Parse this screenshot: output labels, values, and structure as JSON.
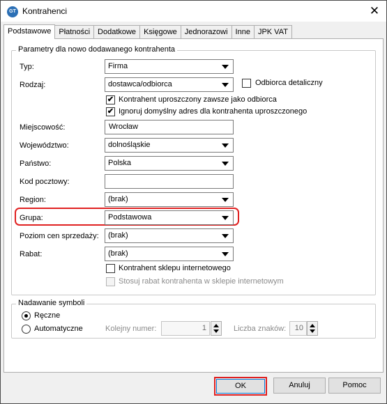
{
  "window": {
    "title": "Kontrahenci",
    "app_icon_text": "GT",
    "close_icon": "close-x-icon"
  },
  "tabs": [
    "Podstawowe",
    "Płatności",
    "Dodatkowe",
    "Księgowe",
    "Jednorazowi",
    "Inne",
    "JPK VAT"
  ],
  "params": {
    "legend": "Parametry dla nowo dodawanego kontrahenta",
    "typ": {
      "label": "Typ:",
      "value": "Firma"
    },
    "rodzaj": {
      "label": "Rodzaj:",
      "value": "dostawca/odbiorca"
    },
    "odbiorca_detaliczny": {
      "label": "Odbiorca detaliczny",
      "checked": false
    },
    "uproszczony": {
      "label": "Kontrahent uproszczony zawsze jako odbiorca",
      "checked": true
    },
    "ignoruj": {
      "label": "Ignoruj domyślny adres dla kontrahenta uproszczonego",
      "checked": true
    },
    "miejscowosc": {
      "label": "Miejscowość:",
      "value": "Wrocław"
    },
    "wojewodztwo": {
      "label": "Województwo:",
      "value": "dolnośląskie"
    },
    "panstwo": {
      "label": "Państwo:",
      "value": "Polska"
    },
    "kod": {
      "label": "Kod pocztowy:",
      "value": ""
    },
    "region": {
      "label": "Region:",
      "value": "(brak)"
    },
    "grupa": {
      "label": "Grupa:",
      "value": "Podstawowa"
    },
    "poziom": {
      "label": "Poziom cen sprzedaży:",
      "value": "(brak)"
    },
    "rabat": {
      "label": "Rabat:",
      "value": "(brak)"
    },
    "sklep": {
      "label": "Kontrahent sklepu internetowego",
      "checked": false
    },
    "stosuj": {
      "label": "Stosuj rabat kontrahenta w sklepie internetowym",
      "checked": false
    }
  },
  "symbols": {
    "legend": "Nadawanie symboli",
    "reczne": {
      "label": "Ręczne",
      "selected": true
    },
    "automatyczne": {
      "label": "Automatyczne",
      "selected": false
    },
    "kolejny": {
      "label": "Kolejny numer:",
      "value": "1"
    },
    "liczba": {
      "label": "Liczba znaków:",
      "value": "10"
    }
  },
  "buttons": {
    "ok": "OK",
    "anuluj": "Anuluj",
    "pomoc": "Pomoc"
  },
  "colors": {
    "highlight": "#e02020",
    "accent": "#0078d7"
  }
}
